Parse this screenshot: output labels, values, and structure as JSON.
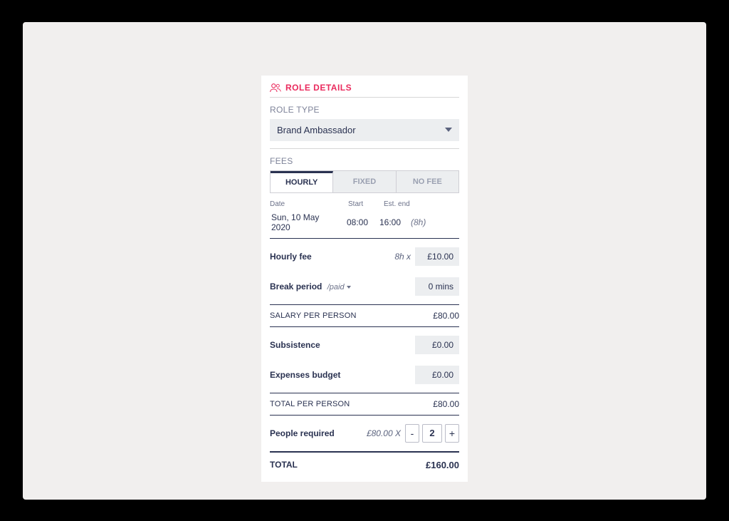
{
  "header": {
    "title": "ROLE DETAILS"
  },
  "role_type": {
    "label": "ROLE TYPE",
    "value": "Brand Ambassador"
  },
  "fees": {
    "label": "FEES",
    "tabs": [
      {
        "label": "HOURLY",
        "active": true
      },
      {
        "label": "FIXED",
        "active": false
      },
      {
        "label": "NO FEE",
        "active": false
      }
    ]
  },
  "schedule": {
    "date_label": "Date",
    "start_label": "Start",
    "end_label": "Est. end",
    "date": "Sun, 10 May 2020",
    "start": "08:00",
    "end": "16:00",
    "duration": "(8h)"
  },
  "rows": {
    "hourly_fee": {
      "label": "Hourly fee",
      "mult": "8h  x",
      "value": "£10.00"
    },
    "break_period": {
      "label": "Break period",
      "badge": "/paid",
      "value": "0 mins"
    },
    "salary_pp": {
      "label": "SALARY PER PERSON",
      "value": "£80.00"
    },
    "subsistence": {
      "label": "Subsistence",
      "value": "£0.00"
    },
    "expenses": {
      "label": "Expenses budget",
      "value": "£0.00"
    },
    "total_pp": {
      "label": "TOTAL PER PERSON",
      "value": "£80.00"
    },
    "people": {
      "label": "People required",
      "unit_price": "£80.00 X",
      "count": "2"
    },
    "total": {
      "label": "TOTAL",
      "value": "£160.00"
    }
  },
  "stepper": {
    "minus": "-",
    "plus": "+"
  }
}
